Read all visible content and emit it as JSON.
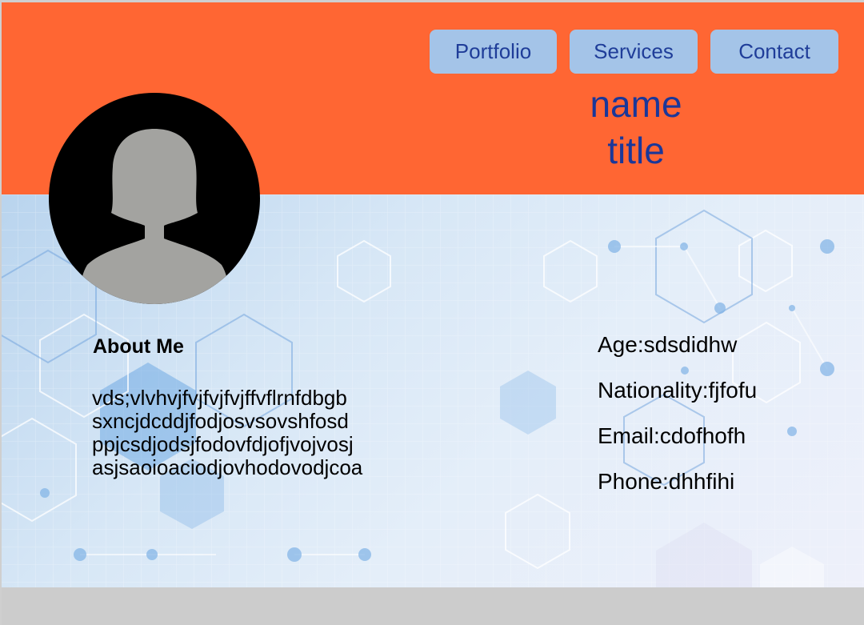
{
  "colors": {
    "header_bg": "#ff6633",
    "nav_button_bg": "#a4c4e8",
    "nav_text": "#1f3d99",
    "hero_text": "#1a3799",
    "footer_bg": "#cccccc"
  },
  "nav": {
    "items": [
      {
        "label": "Portfolio"
      },
      {
        "label": "Services"
      },
      {
        "label": "Contact"
      }
    ]
  },
  "hero": {
    "name": "name",
    "title": "title"
  },
  "avatar": {
    "icon": "person-silhouette-icon"
  },
  "about": {
    "heading": "About Me",
    "lines": [
      "vds;vlvhvjfvjfvjfvjffvflrnfdbgb",
      "sxncjdcddjfodjosvsovshfosd",
      "ppjcsdjodsjfodovfdjofjvojvosj",
      "asjsaoioaciodjovhodovodjcoa"
    ]
  },
  "info": {
    "age": "Age:sdsdidhw",
    "nationality": "Nationality:fjfofu",
    "email": "Email:cdofhofh",
    "phone": "Phone:dhhfihi"
  }
}
